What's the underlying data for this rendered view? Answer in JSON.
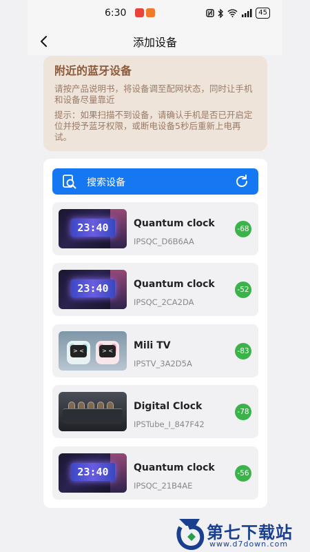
{
  "status_bar": {
    "time": "6:30",
    "battery": "45",
    "icons": [
      "nfc-icon",
      "bluetooth-icon",
      "wifi-icon",
      "signal-icon"
    ]
  },
  "nav": {
    "title": "添加设备"
  },
  "notice": {
    "heading": "附近的蓝牙设备",
    "instruction": "请按产品说明书，将设备调至配网状态，同时让手机和设备尽量靠近",
    "tip": "提示：如果扫描不到设备，请确认手机是否已开启定位并授予蓝牙权限，或断电设备5秒后重新上电再试。"
  },
  "search": {
    "label": "搜索设备"
  },
  "devices": [
    {
      "name": "Quantum clock",
      "id": "IPSQC_D6B6AA",
      "rssi": "-68",
      "thumb": "clock",
      "display": "23:40"
    },
    {
      "name": "Quantum clock",
      "id": "IPSQC_2CA2DA",
      "rssi": "-52",
      "thumb": "clock",
      "display": "23:40"
    },
    {
      "name": "Mili TV",
      "id": "IPSTV_3A2D5A",
      "rssi": "-83",
      "thumb": "tv"
    },
    {
      "name": "Digital Clock",
      "id": "IPSTube_I_847F42",
      "rssi": "-78",
      "thumb": "tube"
    },
    {
      "name": "Quantum clock",
      "id": "IPSQC_21B4AE",
      "rssi": "-56",
      "thumb": "clock",
      "display": "23:40"
    }
  ],
  "watermark": {
    "text": "第七下载站",
    "url": "www.d7down.com"
  },
  "colors": {
    "primary": "#1677f2",
    "signal": "#3bb34a",
    "notice_bg": "#efe4da",
    "notice_heading": "#8a5a3b"
  }
}
